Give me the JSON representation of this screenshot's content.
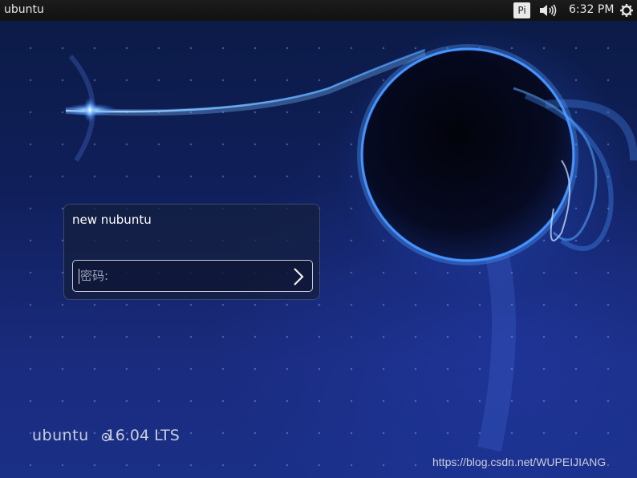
{
  "panel": {
    "hostname": "ubuntu",
    "keyboard_indicator": "Pi",
    "volume_icon": "volume-icon",
    "clock": "6:32 PM",
    "settings_icon": "gear-icon"
  },
  "login": {
    "user_name": "new nubuntu",
    "password_placeholder": "密码:",
    "submit_icon": "chevron-right-icon"
  },
  "branding": {
    "logo_text": "ubuntu",
    "version": "16.04 LTS"
  },
  "watermark": "https://blog.csdn.net/WUPEIJIANG"
}
